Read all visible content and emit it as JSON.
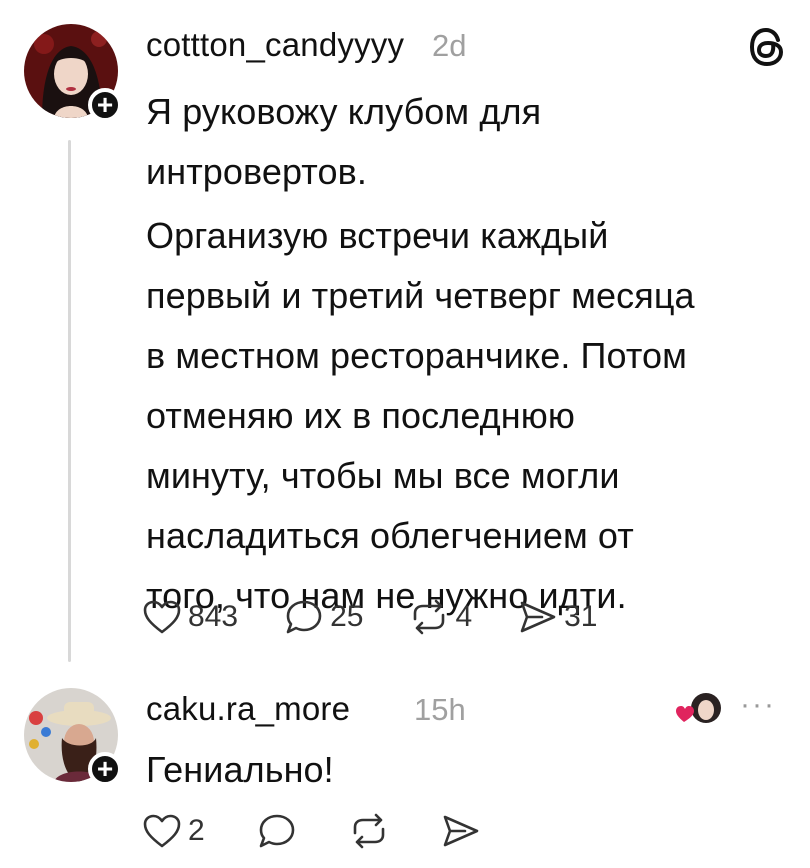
{
  "post": {
    "username": "cottton_candyyyy",
    "time": "2d",
    "paragraphs": [
      "Я руковожу клубом для интровертов.",
      "Организую встречи каждый первый и третий четверг месяца в местном ресторанчике. Потом отменяю их в последнюю минуту, чтобы мы все могли насладиться облегчением от того, что нам не нужно идти."
    ],
    "lines1": [
      "Я руковожу клубом для",
      "интровертов."
    ],
    "lines2": [
      "Организую встречи каждый",
      "первый и третий четверг месяца",
      "в местном ресторанчике. Потом",
      "отменяю их в последнюю",
      "минуту, чтобы мы все могли",
      "насладиться облегчением от",
      "того, что нам не нужно идти."
    ],
    "likes": "843",
    "replies": "25",
    "reposts": "4",
    "shares": "31"
  },
  "reply": {
    "username": "caku.ra_more",
    "time": "15h",
    "text": "Гениально!",
    "likes": "2",
    "more_label": "···"
  },
  "icons": {
    "follow": "plus-icon",
    "app": "threads-logo-icon",
    "like": "heart-icon",
    "reply": "comment-icon",
    "repost": "repost-icon",
    "share": "send-icon"
  },
  "colors": {
    "text": "#111111",
    "muted": "#a0a0a0",
    "heart_liked": "#e0245e"
  }
}
